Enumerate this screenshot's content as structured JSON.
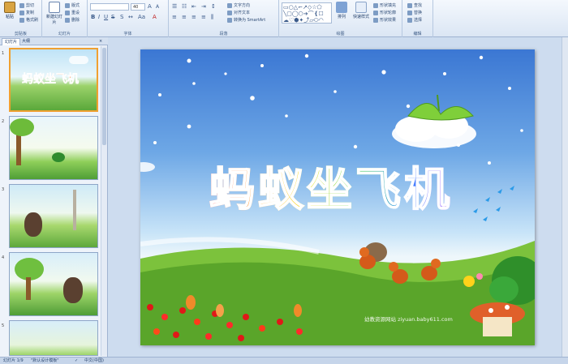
{
  "ribbon": {
    "clipboard": {
      "label": "剪贴板",
      "paste": "粘贴",
      "cut": "剪切",
      "copy": "复制",
      "format_painter": "格式刷"
    },
    "slides": {
      "label": "幻灯片",
      "new_slide": "新建幻灯片",
      "layout": "版式",
      "reset": "重设",
      "delete": "删除"
    },
    "font": {
      "label": "字体",
      "font_name": "",
      "font_size": "40"
    },
    "paragraph": {
      "label": "段落",
      "text_direction": "文字方向",
      "align_text": "对齐文本",
      "smartart": "转换为 SmartArt"
    },
    "drawing": {
      "label": "绘图",
      "arrange": "排列",
      "quick_styles": "快速样式",
      "shape_fill": "形状填充",
      "shape_outline": "形状轮廓",
      "shape_effects": "形状效果"
    },
    "editing": {
      "label": "编辑",
      "find": "查找",
      "replace": "替换",
      "select": "选择"
    }
  },
  "panel": {
    "tabs": [
      "幻灯片",
      "大纲"
    ],
    "close_glyph": "×",
    "thumbnails": [
      {
        "num": "1",
        "title": "蚂蚁坐飞机"
      },
      {
        "num": "2"
      },
      {
        "num": "3"
      },
      {
        "num": "4"
      },
      {
        "num": "5"
      }
    ]
  },
  "slide": {
    "title": "蚂蚁坐飞机",
    "watermark": "幼教资源网站 ziyuan.baby611.com",
    "title_colors": [
      "#ff3b3b",
      "#ff9f1a",
      "#f5e21a",
      "#3fcf3f",
      "#2b8cff",
      "#b04cff"
    ]
  },
  "status": {
    "slide_info": "幻灯片 1/9",
    "theme": "\"默认设计模板\"",
    "language": "中文(中国)"
  }
}
